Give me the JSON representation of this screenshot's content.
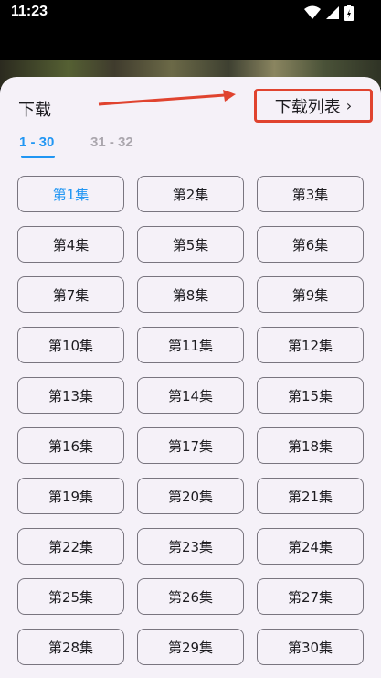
{
  "status_bar": {
    "time": "11:23"
  },
  "sheet": {
    "title": "下载",
    "download_list_label": "下载列表",
    "tabs": [
      {
        "label": "1 - 30",
        "active": true
      },
      {
        "label": "31 - 32",
        "active": false
      }
    ],
    "selected_episode": "第1集",
    "episodes": [
      "第1集",
      "第2集",
      "第3集",
      "第4集",
      "第5集",
      "第6集",
      "第7集",
      "第8集",
      "第9集",
      "第10集",
      "第11集",
      "第12集",
      "第13集",
      "第14集",
      "第15集",
      "第16集",
      "第17集",
      "第18集",
      "第19集",
      "第20集",
      "第21集",
      "第22集",
      "第23集",
      "第24集",
      "第25集",
      "第26集",
      "第27集",
      "第28集",
      "第29集",
      "第30集"
    ]
  },
  "colors": {
    "accent": "#2196f3",
    "annotation": "#e0432f",
    "sheet_bg": "#f5f1f8"
  }
}
